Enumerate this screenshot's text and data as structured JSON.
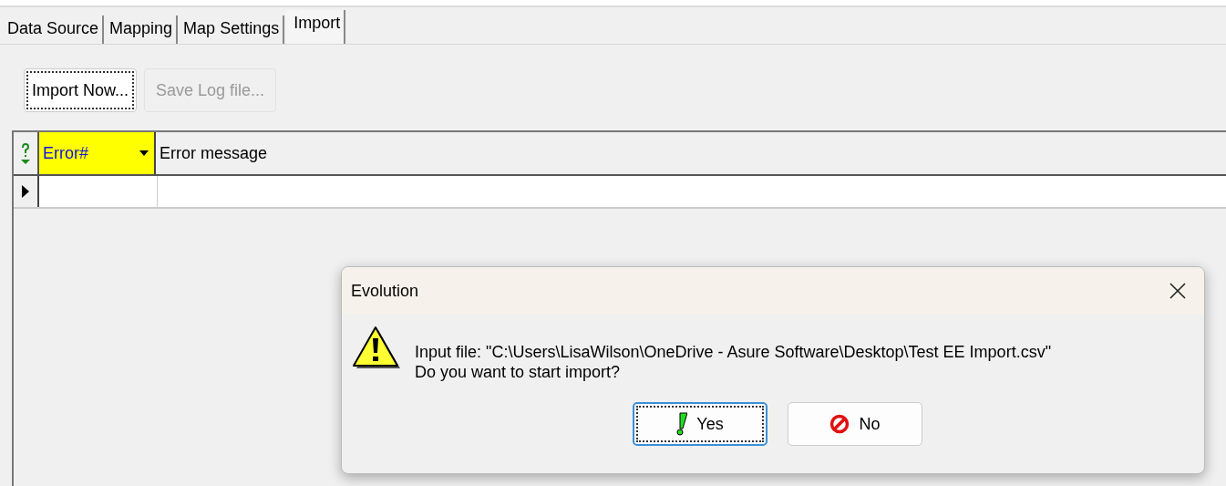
{
  "tabs": [
    {
      "label": "Data Source",
      "selected": false
    },
    {
      "label": "Mapping",
      "selected": false
    },
    {
      "label": "Map Settings",
      "selected": false
    },
    {
      "label": "Import",
      "selected": true
    }
  ],
  "toolbar": [
    {
      "label": "Import Now...",
      "disabled": false,
      "focused": true
    },
    {
      "label": "Save Log file...",
      "disabled": true,
      "focused": false
    }
  ],
  "grid": {
    "columns": [
      {
        "label": "Error#",
        "highlighted": true,
        "dropdown": true
      },
      {
        "label": "Error message",
        "highlighted": false,
        "dropdown": false
      }
    ],
    "rows": [
      {
        "current": true
      }
    ]
  },
  "dialog": {
    "title": "Evolution",
    "message": [
      "Input file: \"C:\\Users\\LisaWilson\\OneDrive - Asure Software\\Desktop\\Test EE Import.csv\"",
      "Do you want to start import?"
    ],
    "buttons": [
      {
        "kind": "yes",
        "label": "Yes",
        "focused": true
      },
      {
        "kind": "no",
        "label": "No",
        "focused": false
      }
    ]
  }
}
